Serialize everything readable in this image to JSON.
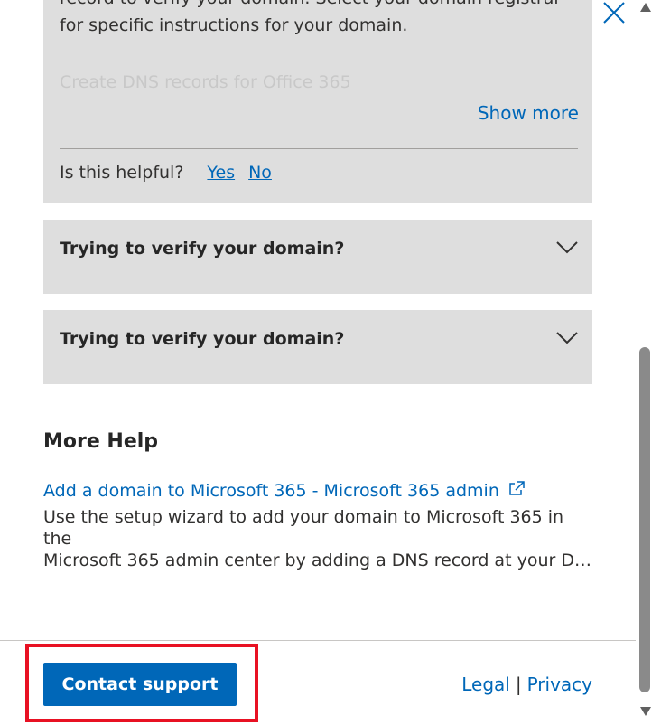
{
  "top_card": {
    "paragraph": "record to verify your domain. Select your domain registrar for specific instructions for your domain.",
    "faded_line": "Create DNS records for Office 365",
    "show_more": "Show more",
    "helpful_question": "Is this helpful?",
    "yes": "Yes",
    "no": "No"
  },
  "accordions": [
    {
      "title": "Trying to verify your domain?"
    },
    {
      "title": "Trying to verify your domain?"
    }
  ],
  "more_help": {
    "title": "More Help",
    "link": "Add a domain to Microsoft 365 - Microsoft 365 admin",
    "desc_line1": "Use the setup wizard to add your domain to Microsoft 365 in the",
    "desc_line2": "Microsoft 365 admin center by adding a DNS record at your DN..."
  },
  "footer": {
    "contact_support": "Contact support",
    "legal": "Legal",
    "separator": "|",
    "privacy": "Privacy"
  },
  "colors": {
    "accent": "#0067b8",
    "card_bg": "#dedede",
    "highlight": "#e81123"
  }
}
